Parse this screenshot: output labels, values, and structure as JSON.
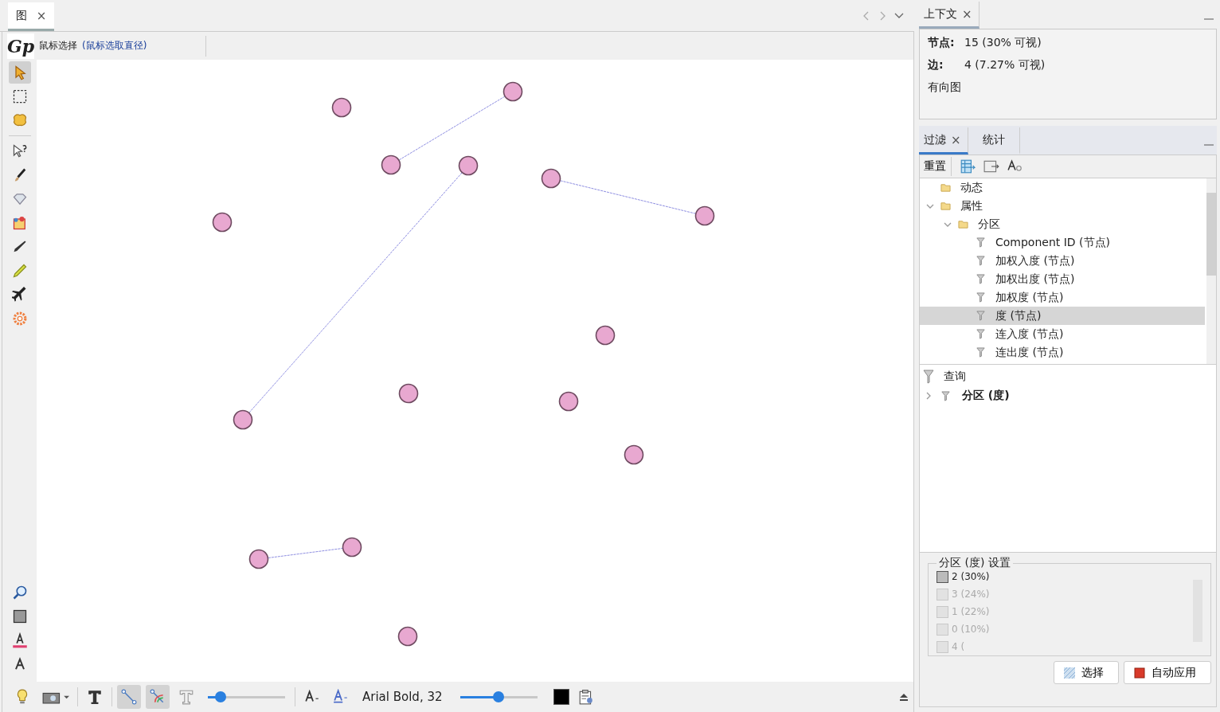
{
  "graph_tab": {
    "title": "图",
    "close": "×"
  },
  "header": {
    "logo": "Gp",
    "mode": "鼠标选择",
    "hint": "(鼠标选取直径)"
  },
  "tools": [
    {
      "selected": true
    },
    {
      "selected": false
    },
    {
      "selected": false
    }
  ],
  "bottom_toolbar": {
    "edges_button_on": true,
    "edge_color_button_on": true,
    "label_size_slider": {
      "level": 0.17
    },
    "font_label": "Arial Bold, 32",
    "font_scale_slider": {
      "level": 0.5
    }
  },
  "context": {
    "tab": "上下文",
    "close": "×",
    "rows": [
      {
        "label": "节点:",
        "value": "15 (30% 可视)"
      },
      {
        "label": "边:",
        "value": "4 (7.27% 可视)"
      }
    ],
    "graph_type": "有向图"
  },
  "filter_tabs": [
    {
      "label": "过滤",
      "selected": true,
      "close": "×"
    },
    {
      "label": "统计",
      "selected": false
    }
  ],
  "reset_button": "重置",
  "library": [
    {
      "label": "动态",
      "kind": "folder"
    },
    {
      "label": "属性",
      "kind": "folder",
      "expanded": true,
      "children": [
        {
          "label": "分区",
          "kind": "folder",
          "expanded": true,
          "children": [
            {
              "label": "Component ID (节点)",
              "kind": "filter",
              "selected": false
            },
            {
              "label": "加权入度 (节点)",
              "kind": "filter",
              "selected": false
            },
            {
              "label": "加权出度 (节点)",
              "kind": "filter",
              "selected": false
            },
            {
              "label": "加权度 (节点)",
              "kind": "filter",
              "selected": false
            },
            {
              "label": "度 (节点)",
              "kind": "filter",
              "selected": true
            },
            {
              "label": "连入度 (节点)",
              "kind": "filter",
              "selected": false
            },
            {
              "label": "连出度 (节点)",
              "kind": "filter",
              "selected": false
            }
          ]
        }
      ]
    }
  ],
  "queries": {
    "title": "查询",
    "items": [
      {
        "label": "分区 (度)",
        "expanded": false
      }
    ]
  },
  "settings": {
    "title": "分区 (度) 设置",
    "parts": [
      {
        "label": "2 (30%)",
        "active": true
      },
      {
        "label": "3 (24%)",
        "active": false
      },
      {
        "label": "1 (22%)",
        "active": false
      },
      {
        "label": "0 (10%)",
        "active": false
      },
      {
        "label": "4 (",
        "active": false
      }
    ]
  },
  "buttons": [
    {
      "label": "选择",
      "kind": "select"
    },
    {
      "label": "自动应用",
      "kind": "auto"
    }
  ]
}
